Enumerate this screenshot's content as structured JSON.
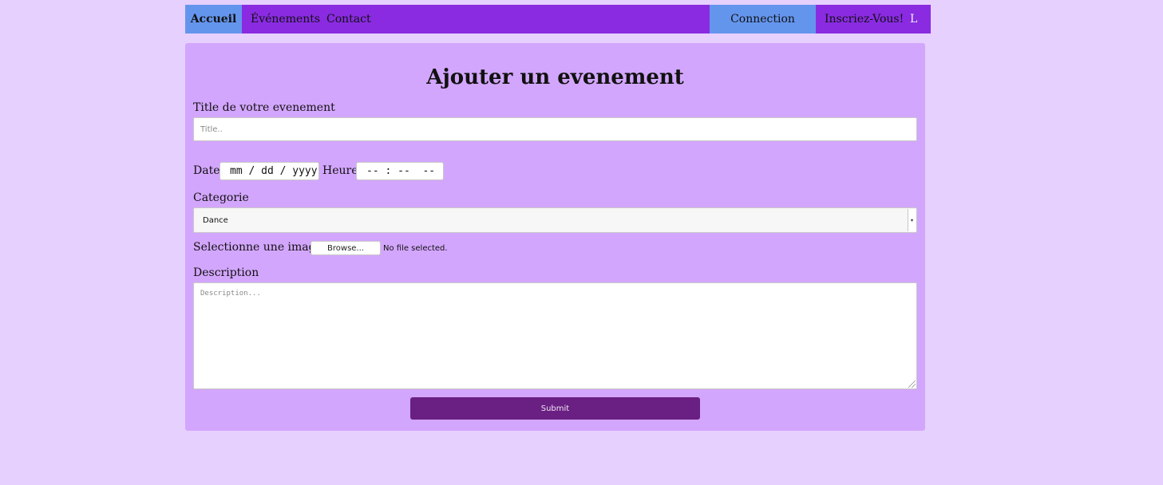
{
  "nav": {
    "home": "Accueil",
    "events": "Événements",
    "contact": "Contact",
    "login": "Connection",
    "signup": "Inscriez-Vous!",
    "lang": "L"
  },
  "form": {
    "heading": "Ajouter un evenement",
    "title_label": "Title de votre evenement",
    "title_placeholder": "Title..",
    "date_label": "Date",
    "date_value": "mm / dd / yyyy",
    "time_label": "Heure",
    "time_value": "-- : --  --",
    "category_label": "Categorie",
    "category_value": "Dance",
    "image_label": "Selectionne une image:",
    "browse_label": "Browse...",
    "file_status": "No file selected.",
    "description_label": "Description",
    "description_placeholder": "Description...",
    "submit_label": "Submit"
  },
  "colors": {
    "page_bg": "#e6d0fe",
    "nav_bg": "#8a2be2",
    "nav_active": "#6495ed",
    "card_bg": "#d3a6fd",
    "submit_bg": "#6a1f82"
  }
}
